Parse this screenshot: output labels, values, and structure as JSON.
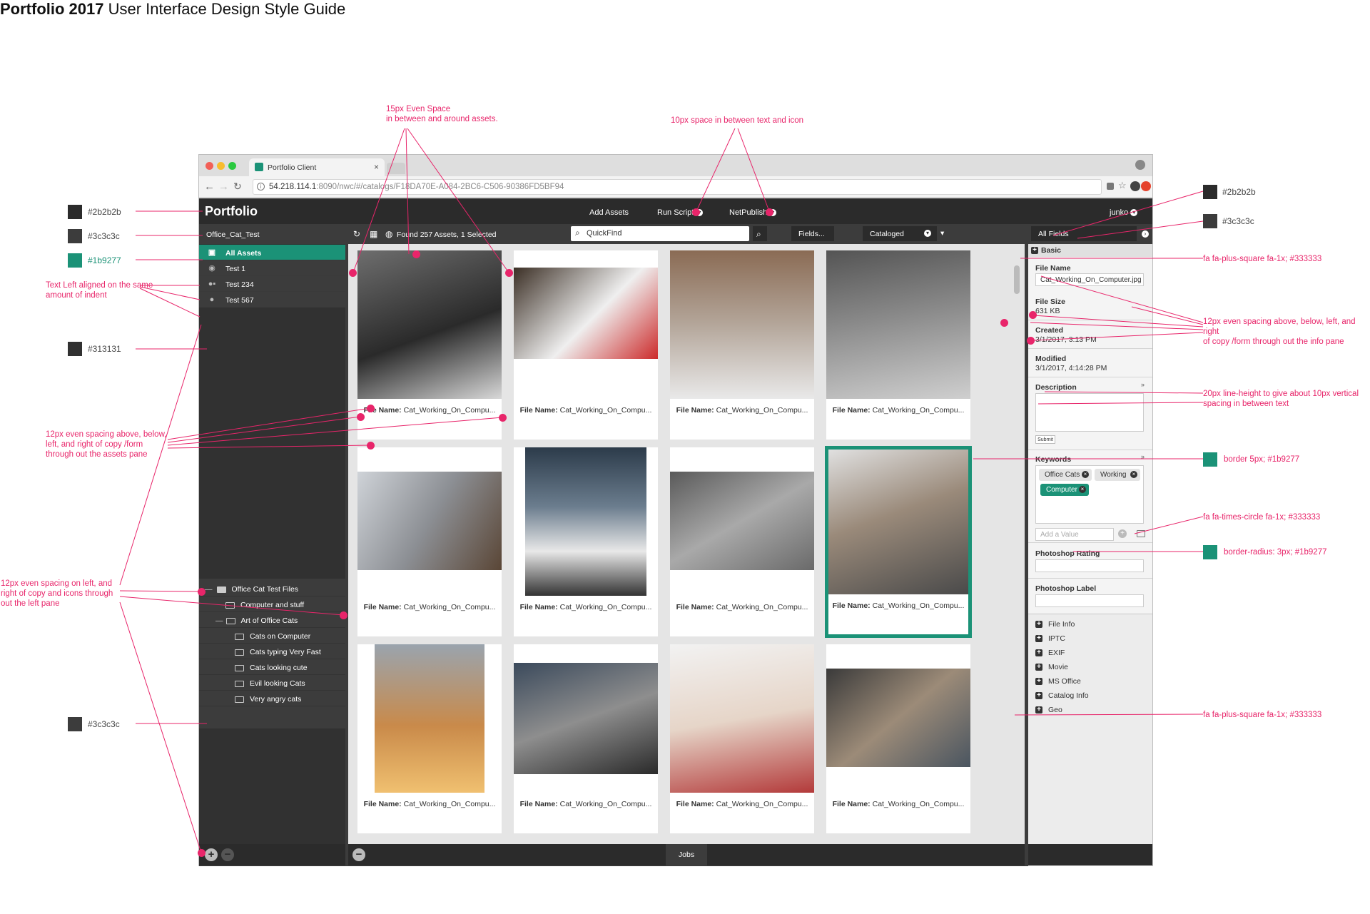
{
  "doc": {
    "title_bold": "Portfolio 2017",
    "title_rest": "User Interface Design Style Guide"
  },
  "annotations": {
    "even_space": "15px Even Space\nin between and around assets.",
    "text_icon": "10px space in between text and icon",
    "left_aligned": "Text Left aligned on the same\namount of indent",
    "assets_spacing": "12px even spacing above, below,\nleft, and right of copy /form\nthrough out the assets pane",
    "left_spacing": "12px even spacing on left, and\nright of copy and icons through\nout the left pane",
    "info_spacing": "12px even spacing above, below, left, and right\nof copy /form through out the info pane",
    "line_height": "20px line-height to give about 10px vertical\nspacing in between text",
    "border": "border 5px; #1b9277",
    "plus_square_1": "fa fa-plus-square fa-1x; #333333",
    "times_circle": "fa fa-times-circle fa-1x; #333333",
    "border_radius": "border-radius: 3px; #1b9277",
    "plus_square_2": "fa fa-plus-square fa-1x; #333333"
  },
  "swatches": {
    "left": [
      {
        "label": "#2b2b2b",
        "color": "#2b2b2b"
      },
      {
        "label": "#3c3c3c",
        "color": "#3c3c3c"
      },
      {
        "label": "#1b9277",
        "color": "#1b9277"
      },
      {
        "label": "#313131",
        "color": "#313131"
      },
      {
        "label": "#3c3c3c",
        "color": "#3c3c3c"
      }
    ],
    "right": [
      {
        "label": "#2b2b2b",
        "color": "#2b2b2b"
      },
      {
        "label": "#3c3c3c",
        "color": "#3c3c3c"
      },
      {
        "label": "",
        "color": "#1b9277"
      },
      {
        "label": "",
        "color": "#1b9277"
      }
    ]
  },
  "browser": {
    "tab_title": "Portfolio Client",
    "url_host": "54.218.114.1",
    "url_rest": ":8090/nwc/#/catalogs/F18DA70E-A084-2BC6-C506-90386FD5BF94"
  },
  "app": {
    "logo": "Portfolio",
    "nav": {
      "add_assets": "Add Assets",
      "run_script": "Run Script",
      "net_publish": "NetPublish",
      "user": "junko"
    },
    "catalog": "Office_Cat_Test",
    "left_items": [
      {
        "label": "All Assets",
        "icon": "briefcase-icon"
      },
      {
        "label": "Test 1",
        "icon": "eye-icon"
      },
      {
        "label": "Test 234",
        "icon": "users-lock-icon"
      },
      {
        "label": "Test 567",
        "icon": "user-icon"
      }
    ],
    "folders": [
      {
        "label": "Office Cat Test Files"
      },
      {
        "label": "Computer and stuff"
      },
      {
        "label": "Art of Office Cats"
      },
      {
        "label": "Cats on Computer"
      },
      {
        "label": "Cats typing Very Fast"
      },
      {
        "label": "Cats looking cute"
      },
      {
        "label": "Evil looking Cats"
      },
      {
        "label": "Very angry cats"
      }
    ],
    "toolbar": {
      "found": "Found 257 Assets, 1 Selected",
      "quickfind": "QuickFind",
      "fields": "Fields...",
      "cataloged": "Cataloged"
    },
    "assets": [
      {
        "label": "File Name:",
        "value": "Cat_Working_On_Compu..."
      },
      {
        "label": "File Name:",
        "value": "Cat_Working_On_Compu..."
      },
      {
        "label": "File Name:",
        "value": "Cat_Working_On_Compu..."
      },
      {
        "label": "File Name:",
        "value": "Cat_Working_On_Compu..."
      },
      {
        "label": "File Name:",
        "value": "Cat_Working_On_Compu..."
      },
      {
        "label": "File Name:",
        "value": "Cat_Working_On_Compu..."
      },
      {
        "label": "File Name:",
        "value": "Cat_Working_On_Compu..."
      },
      {
        "label": "File Name:",
        "value": "Cat_Working_On_Compu...",
        "selected": true
      },
      {
        "label": "File Name:",
        "value": "Cat_Working_On_Compu..."
      },
      {
        "label": "File Name:",
        "value": "Cat_Working_On_Compu..."
      },
      {
        "label": "File Name:",
        "value": "Cat_Working_On_Compu..."
      },
      {
        "label": "File Name:",
        "value": "Cat_Working_On_Compu..."
      }
    ],
    "jobs": "Jobs",
    "info": {
      "dropdown": "All Fields",
      "basic": "Basic",
      "file_name_label": "File Name",
      "file_name_value": "Cat_Working_On_Computer.jpg",
      "file_size_label": "File Size",
      "file_size_value": "631 KB",
      "created_label": "Created",
      "created_value": "3/1/2017, 3:13 PM",
      "modified_label": "Modified",
      "modified_value": "3/1/2017, 4:14:28 PM",
      "description_label": "Description",
      "submit": "Submit",
      "keywords_label": "Keywords",
      "keywords": [
        "Office Cats",
        "Working",
        "Computer"
      ],
      "add_value_placeholder": "Add a Value",
      "photoshop_rating": "Photoshop Rating",
      "photoshop_label": "Photoshop Label",
      "sections": [
        "File Info",
        "IPTC",
        "EXIF",
        "Movie",
        "MS Office",
        "Catalog Info",
        "Geo"
      ]
    }
  }
}
